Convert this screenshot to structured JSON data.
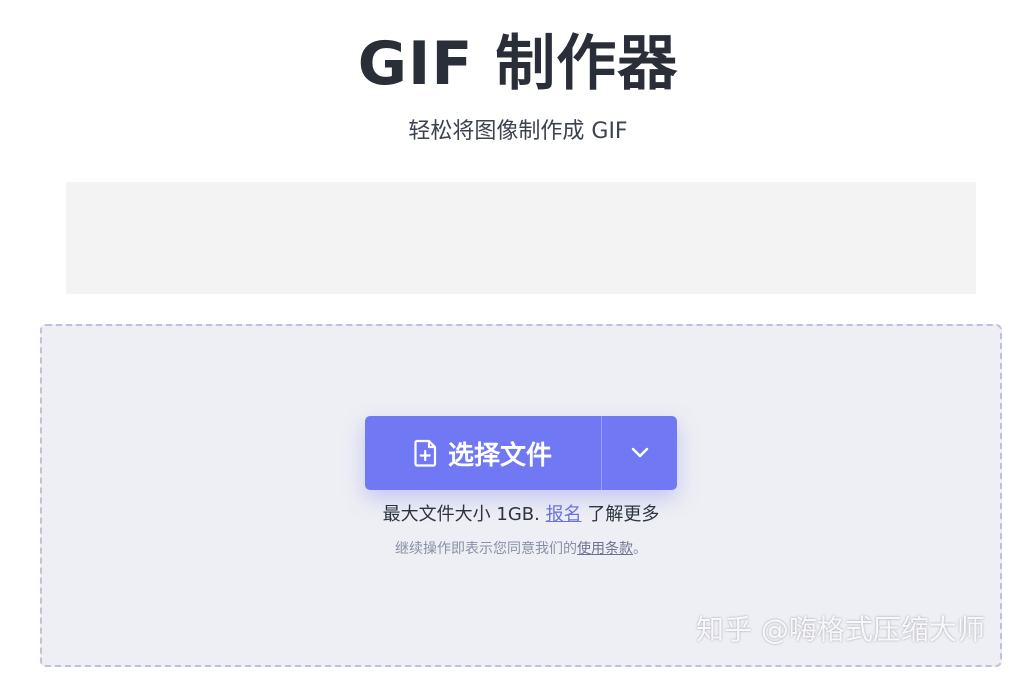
{
  "header": {
    "title": "GIF 制作器",
    "subtitle": "轻松将图像制作成 GIF"
  },
  "upload": {
    "choose_button_label": "选择文件",
    "choose_button_icon": "file-plus-icon",
    "dropdown_icon": "chevron-down-icon",
    "size_info_prefix": "最大文件大小 1GB.",
    "signup_link": "报名",
    "size_info_suffix": "了解更多",
    "terms_prefix": "继续操作即表示您同意我们的",
    "terms_link": "使用条款",
    "terms_suffix": "。"
  },
  "watermark": {
    "text": "知乎 @嗨格式压缩大师"
  },
  "colors": {
    "accent": "#7079f3",
    "dropzone_bg": "#eeeff4",
    "dropzone_border": "#c3bde0",
    "title": "#2a2e39"
  }
}
